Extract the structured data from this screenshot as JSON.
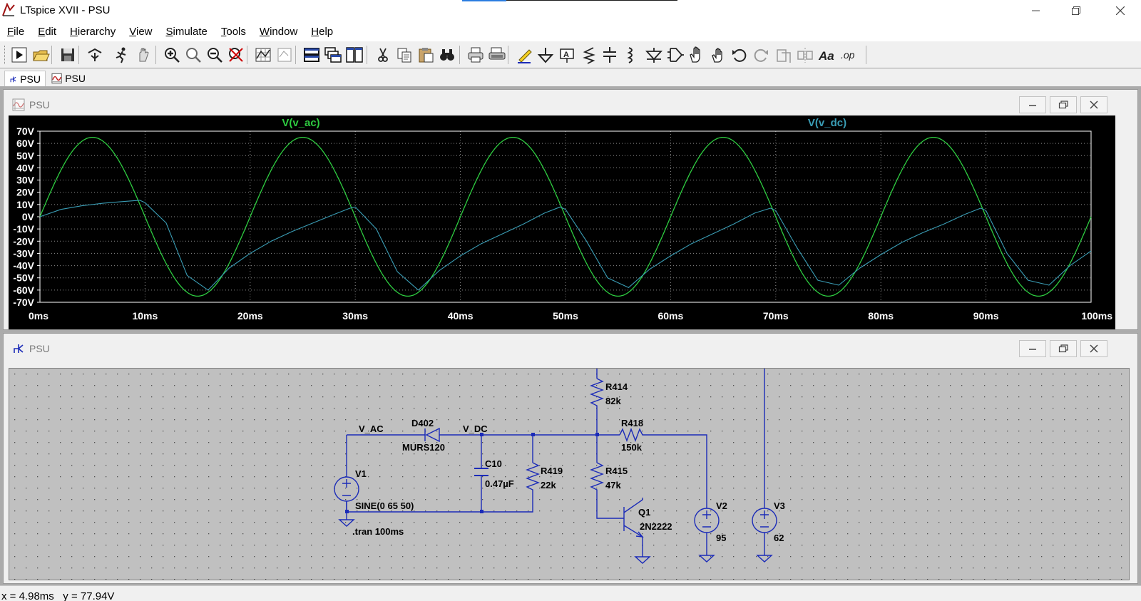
{
  "app": {
    "title": "LTspice XVII - PSU"
  },
  "colors": {
    "trace_ac": "#2ecc40",
    "trace_dc": "#3a9db5",
    "wire": "#1b2bb8",
    "schematic_bg": "#c0c0c0",
    "plot_bg": "#000000",
    "grid": "#8a8a8a"
  },
  "menu": {
    "items": [
      {
        "first": "F",
        "rest": "ile"
      },
      {
        "first": "E",
        "rest": "dit"
      },
      {
        "first": "H",
        "rest": "ierarchy"
      },
      {
        "first": "V",
        "rest": "iew"
      },
      {
        "first": "S",
        "rest": "imulate"
      },
      {
        "first": "T",
        "rest": "ools"
      },
      {
        "first": "W",
        "rest": "indow"
      },
      {
        "first": "H",
        "rest": "elp"
      }
    ]
  },
  "toolbar": {
    "icons": [
      "run-icon",
      "open-icon",
      "save-icon",
      "control-panel-icon",
      "run-sim-icon",
      "halt-icon",
      "zoom-in-icon",
      "zoom-pan-icon",
      "zoom-out-icon",
      "zoom-fit-icon",
      "autorange-icon",
      "add-trace-icon",
      "tile-horizontal-icon",
      "cascade-icon",
      "tile-vertical-icon",
      "cut-icon",
      "copy-icon",
      "paste-icon",
      "find-icon",
      "print-icon",
      "print-setup-icon",
      "draw-wire-icon",
      "ground-icon",
      "label-net-icon",
      "resistor-icon",
      "capacitor-icon",
      "inductor-icon",
      "diode-icon",
      "component-icon",
      "move-icon",
      "drag-icon",
      "undo-icon",
      "redo-icon",
      "rotate-icon",
      "mirror-icon",
      "text-icon",
      "spice-directive-icon"
    ],
    "op_label": ".op"
  },
  "tabs": [
    {
      "label": "PSU",
      "icon": "schematic-icon"
    },
    {
      "label": "PSU",
      "icon": "waveform-icon"
    }
  ],
  "plot_window": {
    "title": "PSU"
  },
  "schematic_window": {
    "title": "PSU"
  },
  "chart_data": {
    "type": "line",
    "title": "",
    "xlabel": "",
    "ylabel": "",
    "xlim": [
      0,
      100
    ],
    "ylim": [
      -70,
      70
    ],
    "x_ticks": [
      "0ms",
      "10ms",
      "20ms",
      "30ms",
      "40ms",
      "50ms",
      "60ms",
      "70ms",
      "80ms",
      "90ms",
      "100ms"
    ],
    "y_ticks": [
      "70V",
      "60V",
      "50V",
      "40V",
      "30V",
      "20V",
      "10V",
      "0V",
      "-10V",
      "-20V",
      "-30V",
      "-40V",
      "-50V",
      "-60V",
      "-70V"
    ],
    "grid": true,
    "series": [
      {
        "name": "V(v_ac)",
        "color": "#2ecc40",
        "amplitude": 65,
        "frequency_hz": 50,
        "x": [
          0,
          5,
          10,
          15,
          20,
          25,
          30,
          35,
          40,
          45,
          50,
          55,
          60,
          65,
          70,
          75,
          80,
          85,
          90,
          95,
          100
        ],
        "y": [
          0,
          65,
          0,
          -65,
          0,
          65,
          0,
          -65,
          0,
          65,
          0,
          -65,
          0,
          65,
          0,
          -65,
          0,
          65,
          0,
          -65,
          0
        ]
      },
      {
        "name": "V(v_dc)",
        "color": "#3a9db5",
        "x": [
          0,
          2,
          4,
          6,
          8,
          9.5,
          10,
          12,
          14,
          16,
          18,
          20,
          22,
          24,
          26,
          28,
          29.5,
          30,
          32,
          34,
          36,
          38,
          40,
          42,
          44,
          46,
          48,
          49.5,
          50,
          52,
          54,
          56,
          58,
          60,
          62,
          64,
          66,
          68,
          69.5,
          70,
          72,
          74,
          76,
          78,
          80,
          82,
          84,
          86,
          88,
          89.5,
          90,
          92,
          94,
          96,
          98,
          100
        ],
        "y": [
          0,
          6,
          9,
          11,
          12.5,
          13.5,
          11.5,
          -5,
          -48,
          -60,
          -42,
          -30,
          -20,
          -12,
          -5,
          2,
          7,
          8,
          -10,
          -45,
          -60,
          -44,
          -32,
          -22,
          -14,
          -6,
          3,
          8,
          6,
          -20,
          -50,
          -58,
          -43,
          -32,
          -22,
          -14,
          -6,
          3,
          7,
          5,
          -25,
          -52,
          -56,
          -42,
          -31,
          -21,
          -13,
          -6,
          2,
          7,
          5,
          -30,
          -52,
          -56,
          -40,
          -28
        ]
      }
    ]
  },
  "schematic": {
    "net_labels": {
      "v_ac": "V_AC",
      "v_dc": "V_DC"
    },
    "components": {
      "d402": {
        "name": "D402",
        "value": "MURS120"
      },
      "c10": {
        "name": "C10",
        "value": "0.47µF"
      },
      "r419": {
        "name": "R419",
        "value": "22k"
      },
      "r414": {
        "name": "R414",
        "value": "82k"
      },
      "r418": {
        "name": "R418",
        "value": "150k"
      },
      "r415": {
        "name": "R415",
        "value": "47k"
      },
      "q1": {
        "name": "Q1",
        "value": "2N2222"
      },
      "v1": {
        "name": "V1",
        "value": "SINE(0 65 50)"
      },
      "v2": {
        "name": "V2",
        "value": "95"
      },
      "v3": {
        "name": "V3",
        "value": "62"
      }
    },
    "directive": ".tran 100ms"
  },
  "status": {
    "text": "x = 4.98ms   y = 77.94V"
  }
}
